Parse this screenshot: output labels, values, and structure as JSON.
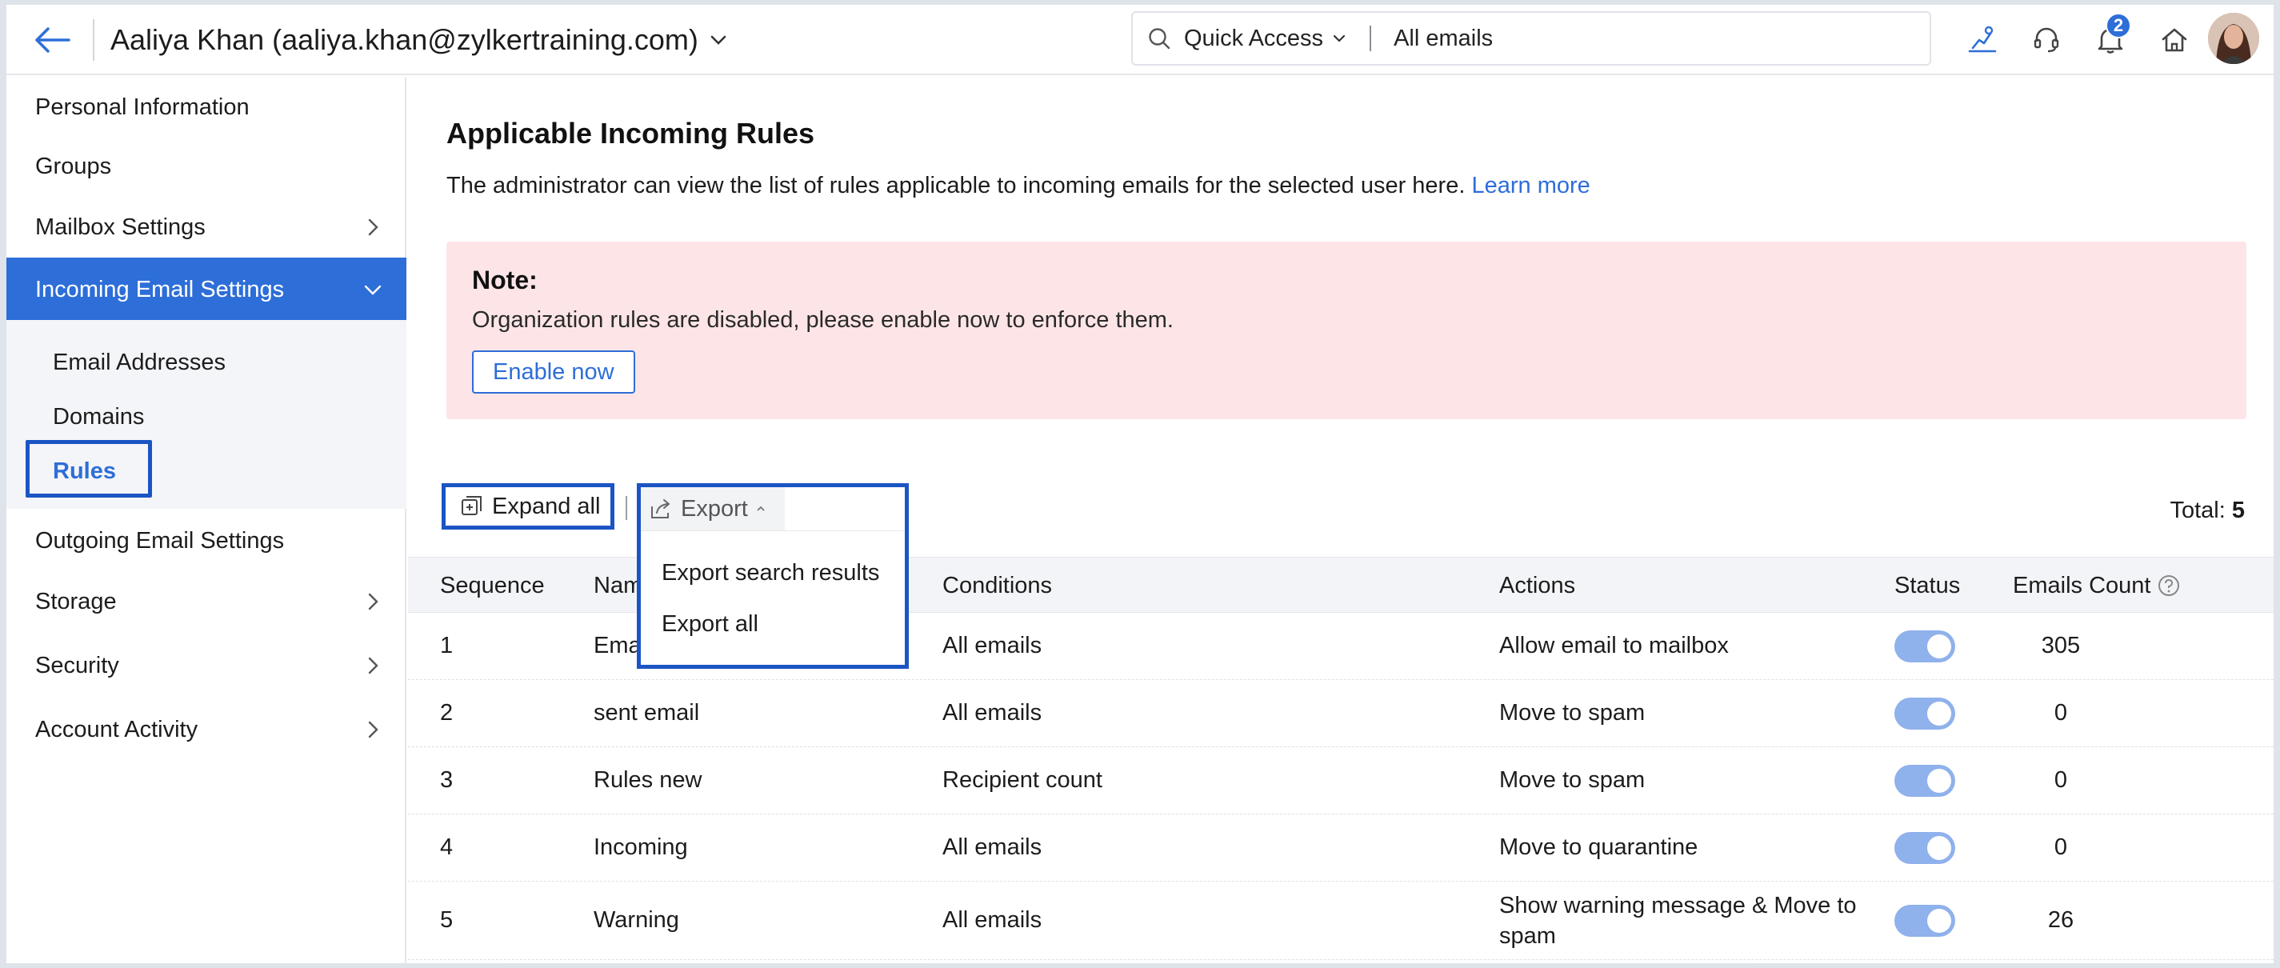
{
  "header": {
    "user_title": "Aaliya Khan (aaliya.khan@zylkertraining.com)",
    "search_scope": "Quick Access",
    "search_value": "All emails",
    "notification_count": "2"
  },
  "sidebar": {
    "items": [
      {
        "label": "Personal Information"
      },
      {
        "label": "Groups"
      },
      {
        "label": "Mailbox Settings"
      },
      {
        "label": "Incoming Email Settings"
      },
      {
        "label": "Outgoing Email Settings"
      },
      {
        "label": "Storage"
      },
      {
        "label": "Security"
      },
      {
        "label": "Account Activity"
      }
    ],
    "sub_items": [
      {
        "label": "Email Addresses"
      },
      {
        "label": "Domains"
      },
      {
        "label": "Rules"
      }
    ]
  },
  "main": {
    "title": "Applicable Incoming Rules",
    "description": "The administrator can view the list of rules applicable to incoming emails for the selected user here.",
    "learn_more": "Learn more",
    "note": {
      "title": "Note:",
      "text": "Organization rules are disabled, please enable now to enforce them.",
      "button": "Enable now"
    },
    "toolbar": {
      "expand_all": "Expand all",
      "export": "Export",
      "export_options": [
        "Export search results",
        "Export all"
      ],
      "total_label": "Total:",
      "total_value": "5"
    },
    "table": {
      "columns": [
        "Sequence",
        "Nam",
        "Conditions",
        "Actions",
        "Status",
        "Emails Count"
      ],
      "rows": [
        {
          "seq": "1",
          "name": "Ema",
          "condition": "All emails",
          "action": "Allow email to mailbox",
          "count": "305"
        },
        {
          "seq": "2",
          "name": "sent email",
          "condition": "All emails",
          "action": "Move to spam",
          "count": "0"
        },
        {
          "seq": "3",
          "name": "Rules new",
          "condition": "Recipient count",
          "action": "Move to spam",
          "count": "0"
        },
        {
          "seq": "4",
          "name": "Incoming",
          "condition": "All emails",
          "action": "Move to quarantine",
          "count": "0"
        },
        {
          "seq": "5",
          "name": "Warning",
          "condition": "All emails",
          "action": "Show warning message & Move to spam",
          "count": "26"
        }
      ]
    }
  },
  "colors": {
    "accent": "#2d6ed8",
    "note_bg": "#fde5e7",
    "highlight_border": "#1b55c4",
    "toggle_on": "#8fb1ec"
  },
  "icons": {
    "back": "arrow-left-icon",
    "search": "search-icon",
    "training": "training-icon",
    "support": "headset-icon",
    "notifications": "bell-icon",
    "home": "home-icon"
  }
}
